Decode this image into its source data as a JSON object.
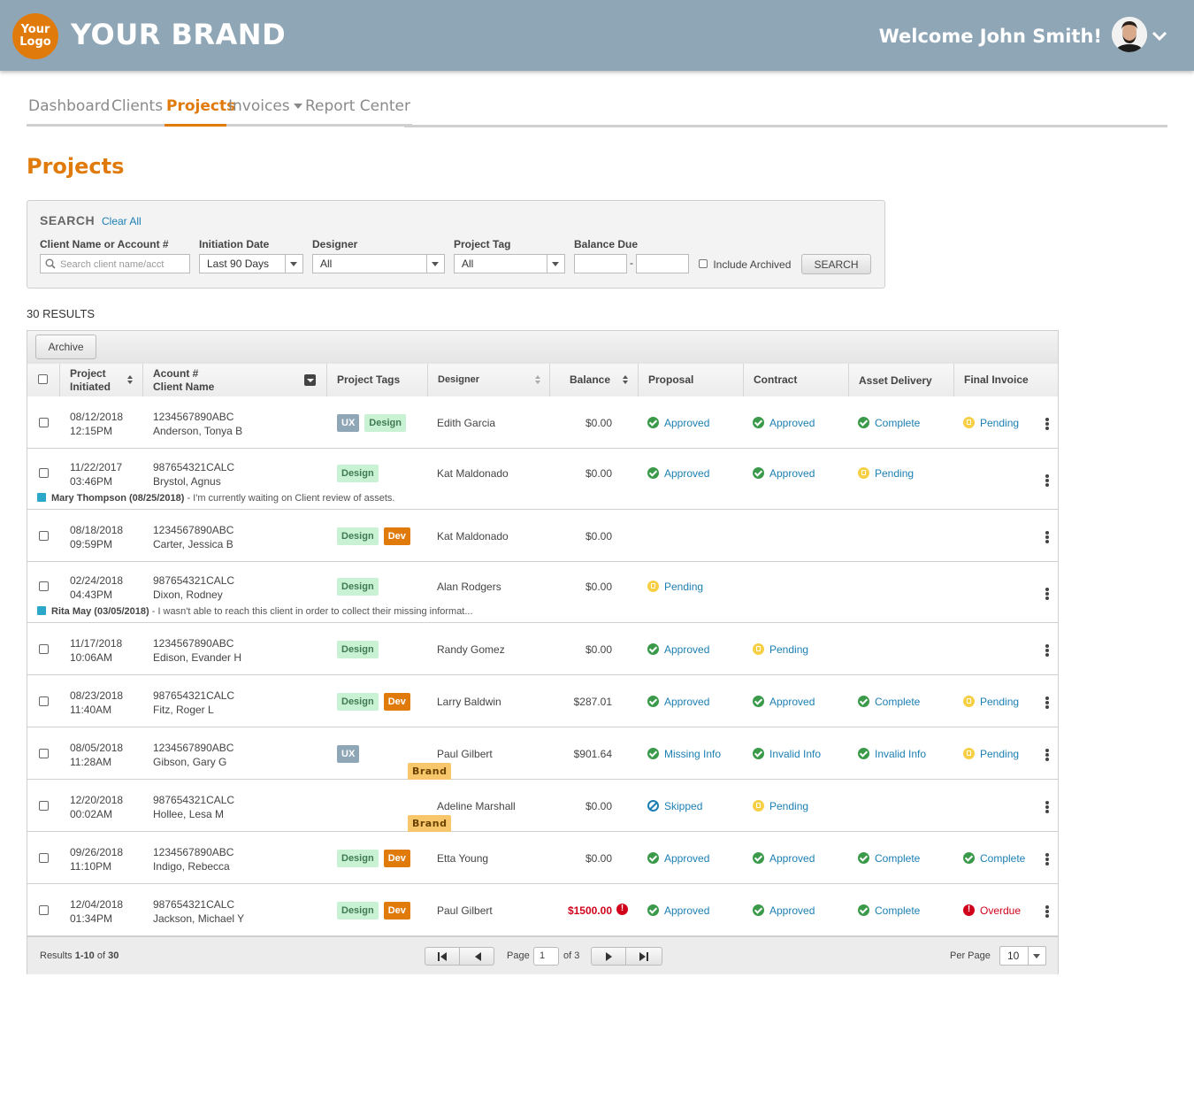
{
  "header": {
    "logo_text_line1": "Your",
    "logo_text_line2": "Logo",
    "brand": "YOUR BRAND",
    "welcome": "Welcome John Smith!"
  },
  "nav": {
    "items": [
      {
        "label": "Dashboard"
      },
      {
        "label": "Clients"
      },
      {
        "label": "Projects",
        "active": true
      },
      {
        "label": "Invoices"
      },
      {
        "label": "Report Center"
      }
    ]
  },
  "page_title": "Projects",
  "search": {
    "title": "SEARCH",
    "clear_all": "Clear All",
    "client_label": "Client Name or Account #",
    "client_placeholder": "Search client name/acct",
    "date_label": "Initiation Date",
    "date_value": "Last 90 Days",
    "designer_label": "Designer",
    "designer_value": "All",
    "tag_label": "Project Tag",
    "tag_value": "All",
    "balance_label": "Balance Due",
    "balance_sep": "-",
    "archived_label": "Include Archived",
    "button": "SEARCH"
  },
  "results_count": "30 RESULTS",
  "grid": {
    "archive_button": "Archive",
    "columns": {
      "initiated_line1": "Project",
      "initiated_line2": "Initiated",
      "account_line1": "Acount #",
      "account_line2": "Client Name",
      "tags": "Project Tags",
      "designer": "Designer",
      "balance": "Balance",
      "proposal": "Proposal",
      "contract": "Contract",
      "asset": "Asset Delivery",
      "final": "Final Invoice"
    },
    "rows": [
      {
        "date": "08/12/2018",
        "time": "12:15PM",
        "acct": "1234567890ABC",
        "client": "Anderson, Tonya B",
        "tags": [
          "UX",
          "Design"
        ],
        "designer": "Edith Garcia",
        "balance": "$0.00",
        "proposal": "Approved",
        "contract": "Approved",
        "asset": "Complete",
        "final": "Pending"
      },
      {
        "date": "11/22/2017",
        "time": "03:46PM",
        "acct": "987654321CALC",
        "client": "Brystol, Agnus",
        "tags": [
          "Design"
        ],
        "designer": "Kat Maldonado",
        "balance": "$0.00",
        "proposal": "Approved",
        "contract": "Approved",
        "asset": "Pending",
        "final": "",
        "note_author": "Mary Thompson (08/25/2018)",
        "note_text": " - I'm currently waiting on Client review of assets."
      },
      {
        "date": "08/18/2018",
        "time": "09:59PM",
        "acct": "1234567890ABC",
        "client": "Carter, Jessica B",
        "tags": [
          "Design",
          "Dev"
        ],
        "designer": "Kat Maldonado",
        "balance": "$0.00",
        "proposal": "",
        "contract": "",
        "asset": "",
        "final": ""
      },
      {
        "date": "02/24/2018",
        "time": "04:43PM",
        "acct": "987654321CALC",
        "client": "Dixon, Rodney",
        "tags": [
          "Design"
        ],
        "designer": "Alan Rodgers",
        "balance": "$0.00",
        "proposal": "Pending",
        "contract": "",
        "asset": "",
        "final": "",
        "note_author": "Rita May (03/05/2018)",
        "note_text": " - I wasn't able to reach this client in order to collect their missing informat..."
      },
      {
        "date": "11/17/2018",
        "time": "10:06AM",
        "acct": "1234567890ABC",
        "client": "Edison, Evander H",
        "tags": [
          "Design"
        ],
        "designer": "Randy Gomez",
        "balance": "$0.00",
        "proposal": "Approved",
        "contract": "Pending",
        "asset": "",
        "final": ""
      },
      {
        "date": "08/23/2018",
        "time": "11:40AM",
        "acct": "987654321CALC",
        "client": "Fitz, Roger L",
        "tags": [
          "Design",
          "Dev"
        ],
        "designer": "Larry Baldwin",
        "balance": "$287.01",
        "proposal": "Approved",
        "contract": "Approved",
        "asset": "Complete",
        "final": "Pending"
      },
      {
        "date": "08/05/2018",
        "time": "11:28AM",
        "acct": "1234567890ABC",
        "client": "Gibson, Gary G",
        "tags": [
          "Brand",
          "UX"
        ],
        "designer": "Paul Gilbert",
        "balance": "$901.64",
        "proposal": "Missing Info",
        "contract": "Invalid Info",
        "asset": "Invalid Info",
        "final": "Pending"
      },
      {
        "date": "12/20/2018",
        "time": "00:02AM",
        "acct": "987654321CALC",
        "client": "Hollee, Lesa M",
        "tags": [
          "Brand"
        ],
        "designer": "Adeline Marshall",
        "balance": "$0.00",
        "proposal": "Skipped",
        "contract": "Pending",
        "asset": "",
        "final": ""
      },
      {
        "date": "09/26/2018",
        "time": "11:10PM",
        "acct": "1234567890ABC",
        "client": "Indigo, Rebecca",
        "tags": [
          "Design",
          "Dev"
        ],
        "designer": "Etta Young",
        "balance": "$0.00",
        "proposal": "Approved",
        "contract": "Approved",
        "asset": "Complete",
        "final": "Complete"
      },
      {
        "date": "12/04/2018",
        "time": "01:34PM",
        "acct": "987654321CALC",
        "client": "Jackson, Michael Y",
        "tags": [
          "Design",
          "Dev"
        ],
        "designer": "Paul Gilbert",
        "balance": "$1500.00",
        "balance_overdue": true,
        "proposal": "Approved",
        "contract": "Approved",
        "asset": "Complete",
        "final": "Overdue"
      }
    ],
    "footer": {
      "results_prefix": "Results ",
      "results_range": "1-10",
      "results_of": " of ",
      "results_total": "30",
      "page_label": "Page",
      "page_value": "1",
      "page_of": "of 3",
      "per_page_label": "Per Page",
      "per_page_value": "10"
    }
  },
  "colors": {
    "header_bg": "#8fa6b6",
    "accent": "#e07b0b",
    "link": "#1b7fb3",
    "approved": "#3a9a4a",
    "pending": "#f6cf45",
    "overdue": "#d0021b"
  }
}
